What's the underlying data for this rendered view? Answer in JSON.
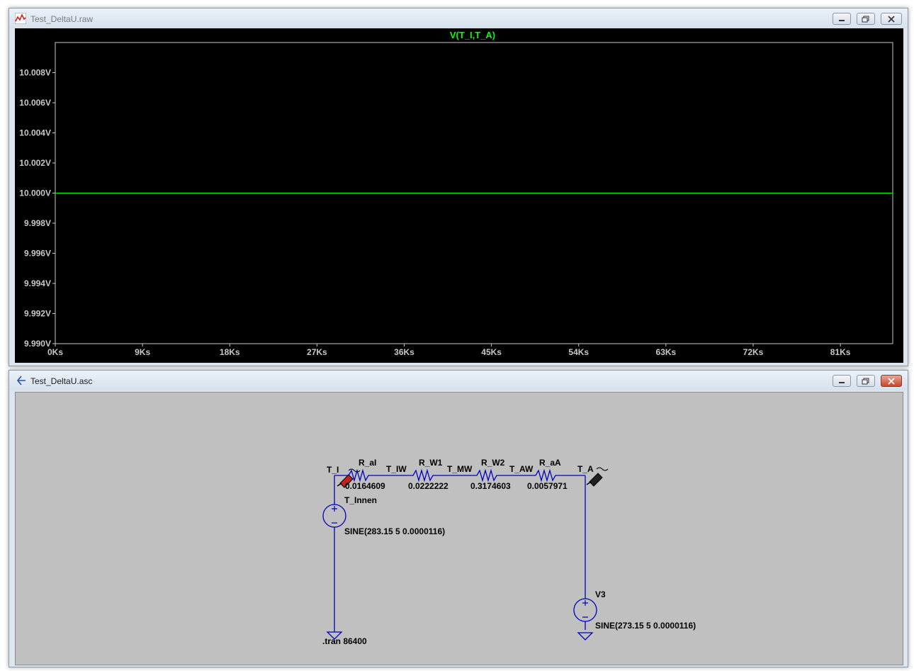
{
  "waveform_window": {
    "title": "Test_DeltaU.raw",
    "trace_label": "V(T_I,T_A)",
    "trace_color": "#00ff00",
    "y_ticks": [
      "10.008V",
      "10.006V",
      "10.004V",
      "10.002V",
      "10.000V",
      "9.998V",
      "9.996V",
      "9.994V",
      "9.992V",
      "9.990V"
    ],
    "x_ticks": [
      "0Ks",
      "9Ks",
      "18Ks",
      "27Ks",
      "36Ks",
      "45Ks",
      "54Ks",
      "63Ks",
      "72Ks",
      "81Ks"
    ]
  },
  "chart_data": {
    "type": "line",
    "title": "V(T_I,T_A)",
    "xlabel": "",
    "ylabel": "",
    "x_unit": "Ks",
    "y_unit": "V",
    "xlim": [
      0,
      86.4
    ],
    "ylim": [
      9.99,
      10.01
    ],
    "grid": false,
    "series": [
      {
        "name": "V(T_I,T_A)",
        "x": [
          0,
          86.4
        ],
        "values": [
          10.0,
          10.0
        ]
      }
    ]
  },
  "schematic_window": {
    "title": "Test_DeltaU.asc",
    "nets": {
      "t_i": "T_I",
      "t_iw": "T_IW",
      "t_mw": "T_MW",
      "t_aw": "T_AW",
      "t_a": "T_A"
    },
    "resistors": [
      {
        "name": "R_aI",
        "value": "0.0164609"
      },
      {
        "name": "R_W1",
        "value": "0.0222222"
      },
      {
        "name": "R_W2",
        "value": "0.3174603"
      },
      {
        "name": "R_aA",
        "value": "0.0057971"
      }
    ],
    "sources": [
      {
        "name": "T_Innen",
        "value": "SINE(283.15 5 0.0000116)"
      },
      {
        "name": "V3",
        "value": "SINE(273.15 5 0.0000116)"
      }
    ],
    "directive": ".tran 86400",
    "wire_color": "#0000c0"
  }
}
